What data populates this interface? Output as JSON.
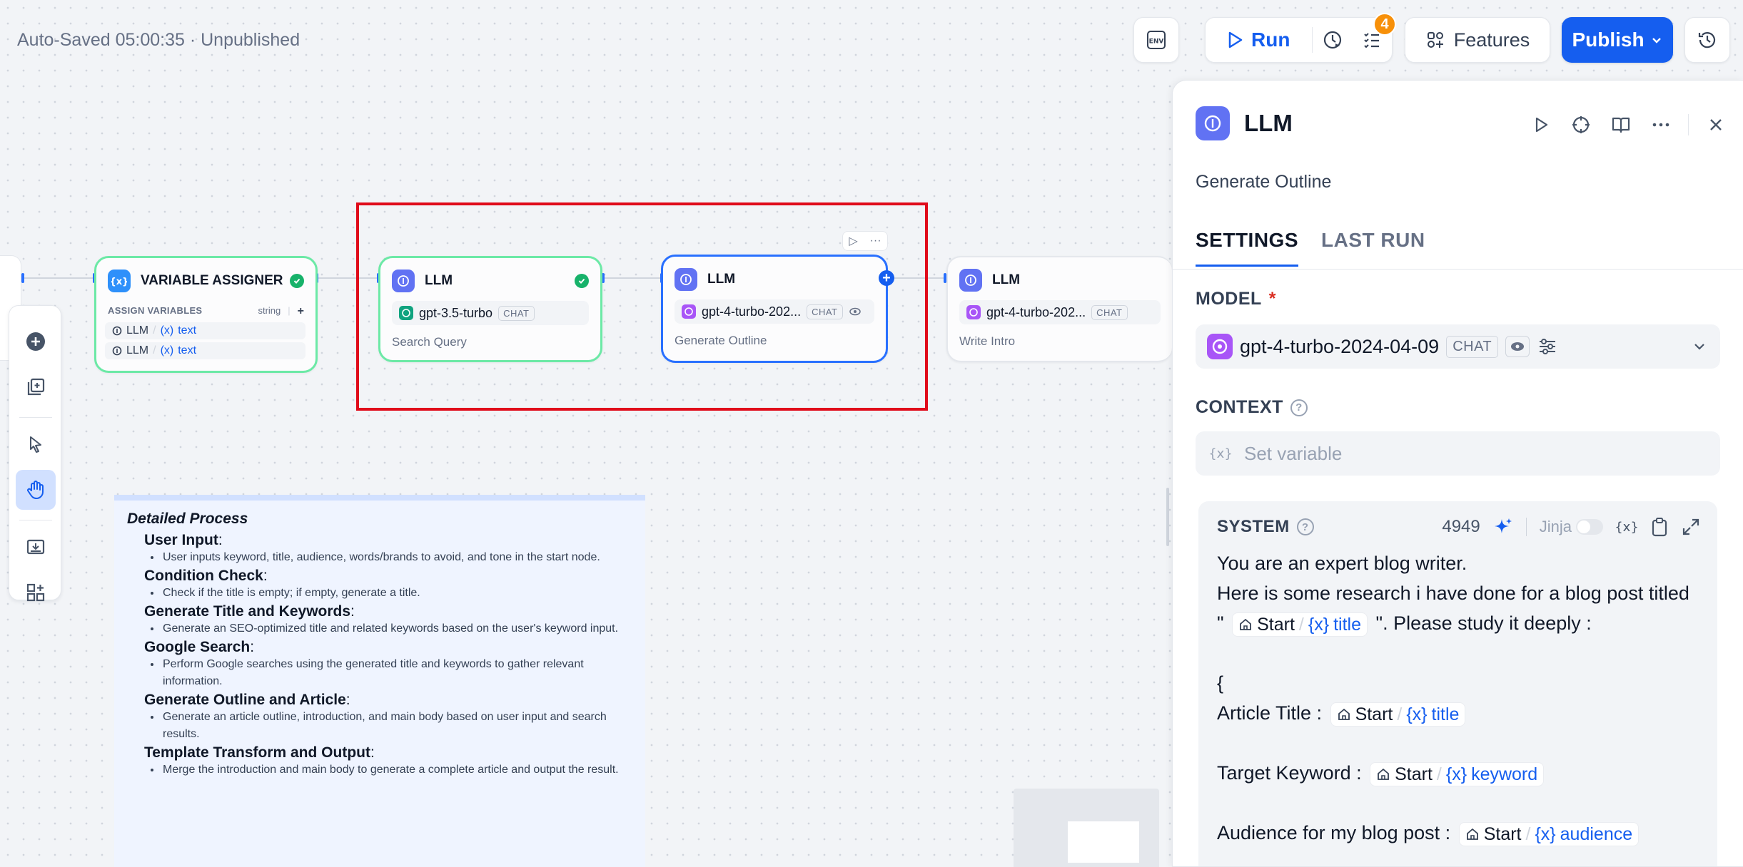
{
  "header": {
    "status": "Auto-Saved 05:00:35 · Unpublished",
    "env_label": "ENV",
    "run_label": "Run",
    "checklist_badge": "4",
    "features_label": "Features",
    "publish_label": "Publish",
    "accent_color": "#155eef"
  },
  "nodes": {
    "variable_assigner": {
      "title": "VARIABLE ASSIGNER",
      "sub_label": "ASSIGN VARIABLES",
      "type_label": "string",
      "rows": [
        {
          "node": "LLM",
          "var": "text"
        },
        {
          "node": "LLM",
          "var": "text"
        }
      ]
    },
    "llm1": {
      "title": "LLM",
      "model": "gpt-3.5-turbo",
      "mode": "CHAT",
      "desc": "Search Query"
    },
    "llm2": {
      "title": "LLM",
      "model": "gpt-4-turbo-202...",
      "mode": "CHAT",
      "desc": "Generate Outline"
    },
    "llm3": {
      "title": "LLM",
      "model": "gpt-4-turbo-202...",
      "mode": "CHAT",
      "desc": "Write Intro"
    }
  },
  "note": {
    "title": "Detailed Process",
    "sections": [
      {
        "title": "User Input",
        "items": [
          "User inputs keyword, title, audience, words/brands to avoid, and tone in the start node."
        ]
      },
      {
        "title": "Condition Check",
        "items": [
          "Check if the title is empty; if empty, generate a title."
        ]
      },
      {
        "title": "Generate Title and Keywords",
        "items": [
          "Generate an SEO-optimized title and related keywords based on the user's keyword input."
        ]
      },
      {
        "title": "Google Search",
        "items": [
          "Perform Google searches using the generated title and keywords to gather relevant information."
        ]
      },
      {
        "title": "Generate Outline and Article",
        "items": [
          "Generate an article outline, introduction, and main body based on user input and search results."
        ]
      },
      {
        "title": "Template Transform and Output",
        "items": [
          "Merge the introduction and main body to generate a complete article and output the result."
        ]
      }
    ]
  },
  "panel": {
    "title": "LLM",
    "description": "Generate Outline",
    "tabs": [
      "SETTINGS",
      "LAST RUN"
    ],
    "model_label": "MODEL",
    "required_mark": "*",
    "model_name": "gpt-4-turbo-2024-04-09",
    "model_mode": "CHAT",
    "context_label": "CONTEXT",
    "context_placeholder": "Set variable",
    "system_label": "SYSTEM",
    "token_count": "4949",
    "jinja_label": "Jinja",
    "prompt": {
      "line1": "You are an expert blog writer.",
      "line2": "Here is some research i have done for a blog post titled",
      "quote_open": "\"",
      "quote_close": "\". Please study it deeply :",
      "brace": "{",
      "article_title": "Article Title :",
      "target_keyword": "Target Keyword :",
      "audience": "Audience for my blog post :",
      "start": "Start",
      "var_title": "title",
      "var_keyword": "keyword",
      "var_audience": "audience"
    }
  }
}
